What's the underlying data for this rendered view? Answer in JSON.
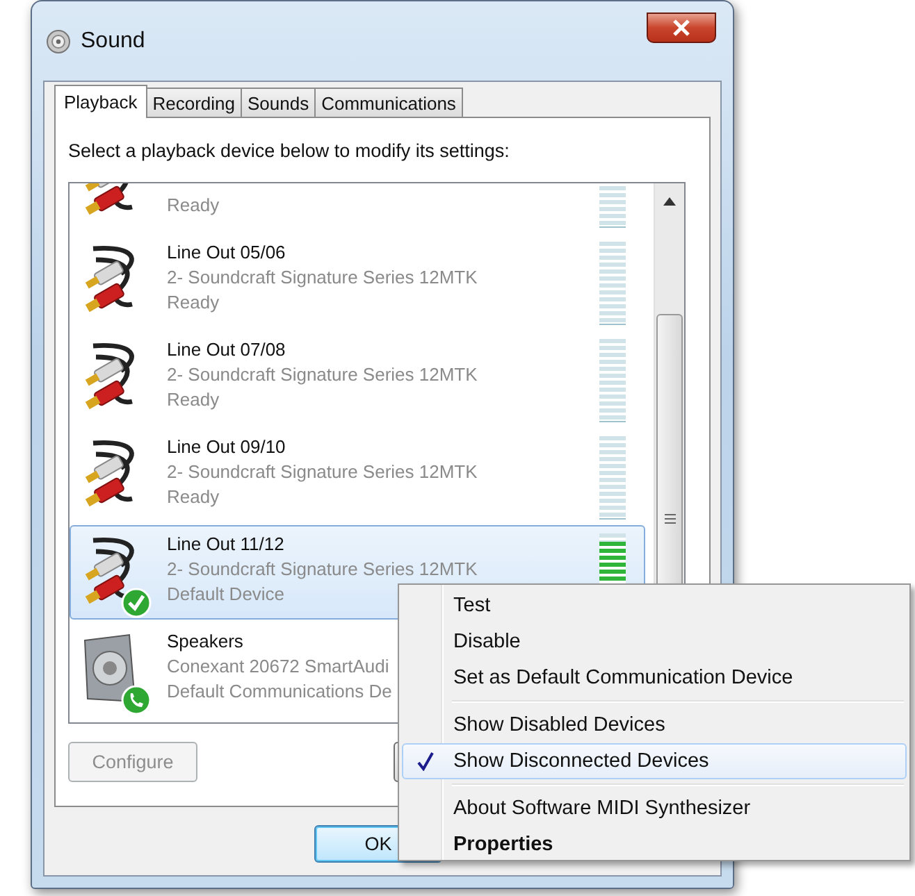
{
  "window": {
    "title": "Sound"
  },
  "tabs": [
    {
      "label": "Playback",
      "selected": true
    },
    {
      "label": "Recording",
      "selected": false
    },
    {
      "label": "Sounds",
      "selected": false
    },
    {
      "label": "Communications",
      "selected": false
    }
  ],
  "instruction": "Select a playback device below to modify its settings:",
  "devices": [
    {
      "kind": "cable",
      "status": "Ready",
      "level": 0,
      "selected": false,
      "default_device": false,
      "communications_default": false
    },
    {
      "kind": "cable",
      "name": "Line Out 05/06",
      "description": "2- Soundcraft Signature Series 12MTK",
      "status": "Ready",
      "level": 0,
      "selected": false,
      "default_device": false,
      "communications_default": false
    },
    {
      "kind": "cable",
      "name": "Line Out 07/08",
      "description": "2- Soundcraft Signature Series 12MTK",
      "status": "Ready",
      "level": 0,
      "selected": false,
      "default_device": false,
      "communications_default": false
    },
    {
      "kind": "cable",
      "name": "Line Out 09/10",
      "description": "2- Soundcraft Signature Series 12MTK",
      "status": "Ready",
      "level": 0,
      "selected": false,
      "default_device": false,
      "communications_default": false
    },
    {
      "kind": "cable",
      "name": "Line Out 11/12",
      "description": "2- Soundcraft Signature Series 12MTK",
      "status": "Default Device",
      "level": 0.9,
      "selected": true,
      "default_device": true,
      "communications_default": false
    },
    {
      "kind": "speaker",
      "name": "Speakers",
      "description": "Conexant 20672 SmartAudi",
      "status": "Default Communications De",
      "selected": false,
      "default_device": false,
      "communications_default": true
    }
  ],
  "configure_button": {
    "label": "Configure",
    "disabled": true
  },
  "ok_button": {
    "label": "OK",
    "default": true
  },
  "context_menu": {
    "items": [
      {
        "kind": "item",
        "label": "Test",
        "checked": false,
        "selected": false,
        "bold": false
      },
      {
        "kind": "item",
        "label": "Disable",
        "checked": false,
        "selected": false,
        "bold": false
      },
      {
        "kind": "item",
        "label": "Set as Default Communication Device",
        "checked": false,
        "selected": false,
        "bold": false
      },
      {
        "kind": "separator"
      },
      {
        "kind": "item",
        "label": "Show Disabled Devices",
        "checked": false,
        "selected": false,
        "bold": false
      },
      {
        "kind": "item",
        "label": "Show Disconnected Devices",
        "checked": true,
        "selected": true,
        "bold": false
      },
      {
        "kind": "separator"
      },
      {
        "kind": "item",
        "label": "About Software MIDI Synthesizer",
        "checked": false,
        "selected": false,
        "bold": false
      },
      {
        "kind": "item",
        "label": "Properties",
        "checked": false,
        "selected": false,
        "bold": true
      }
    ]
  }
}
